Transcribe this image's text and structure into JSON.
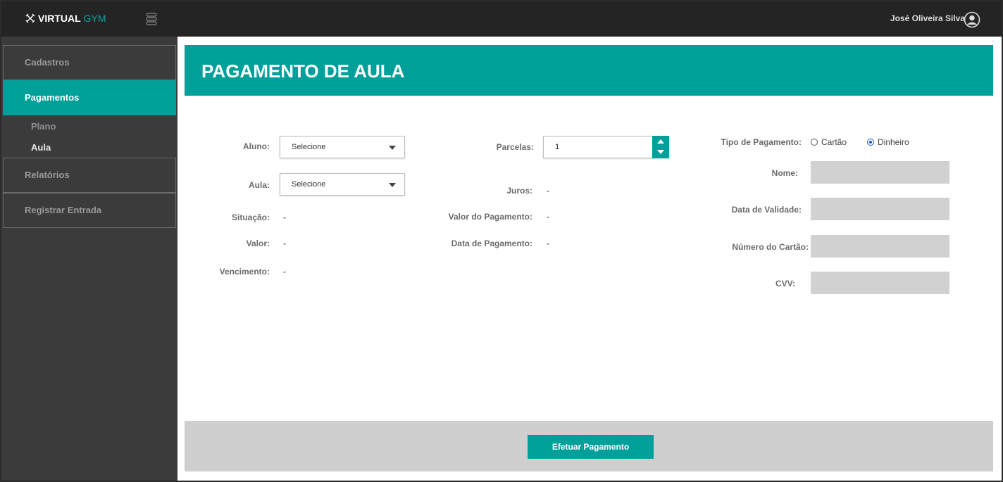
{
  "app": {
    "logo_prefix": "VIRTUAL",
    "logo_suffix": "GYM",
    "user_name": "José Oliveira Silva"
  },
  "sidebar": {
    "items": [
      {
        "label": "Cadastros"
      },
      {
        "label": "Pagamentos"
      },
      {
        "label": "Relatórios"
      },
      {
        "label": "Registrar Entrada"
      }
    ],
    "sub_items": [
      {
        "label": "Plano"
      },
      {
        "label": "Aula"
      }
    ]
  },
  "page": {
    "title": "PAGAMENTO DE AULA"
  },
  "form": {
    "aluno_label": "Aluno:",
    "aluno_value": "Selecione",
    "aula_label": "Aula:",
    "aula_value": "Selecione",
    "situacao_label": "Situação:",
    "situacao_value": "-",
    "valor_label": "Valor:",
    "valor_value": "-",
    "vencimento_label": "Vencimento:",
    "vencimento_value": "-",
    "parcelas_label": "Parcelas:",
    "parcelas_value": "1",
    "juros_label": "Juros:",
    "juros_value": "-",
    "valor_pagamento_label": "Valor do Pagamento:",
    "valor_pagamento_value": "-",
    "data_pagamento_label": "Data de Pagamento:",
    "data_pagamento_value": "-",
    "tipo_pagamento_label": "Tipo de Pagamento:",
    "option_cartao": "Cartão",
    "option_dinheiro": "Dinheiro",
    "selected_option": "Dinheiro",
    "nome_label": "Nome:",
    "data_validade_label": "Data de Validade:",
    "numero_cartao_label": "Número do Cartão:",
    "cvv_label": "CVV:"
  },
  "actions": {
    "pay_label": "Efetuar Pagamento"
  },
  "colors": {
    "accent": "#00a09a",
    "topbar": "#242424",
    "sidebar": "#3b3b3b",
    "footer": "#cfcfcf",
    "disabled_input": "#d1d1d1"
  }
}
